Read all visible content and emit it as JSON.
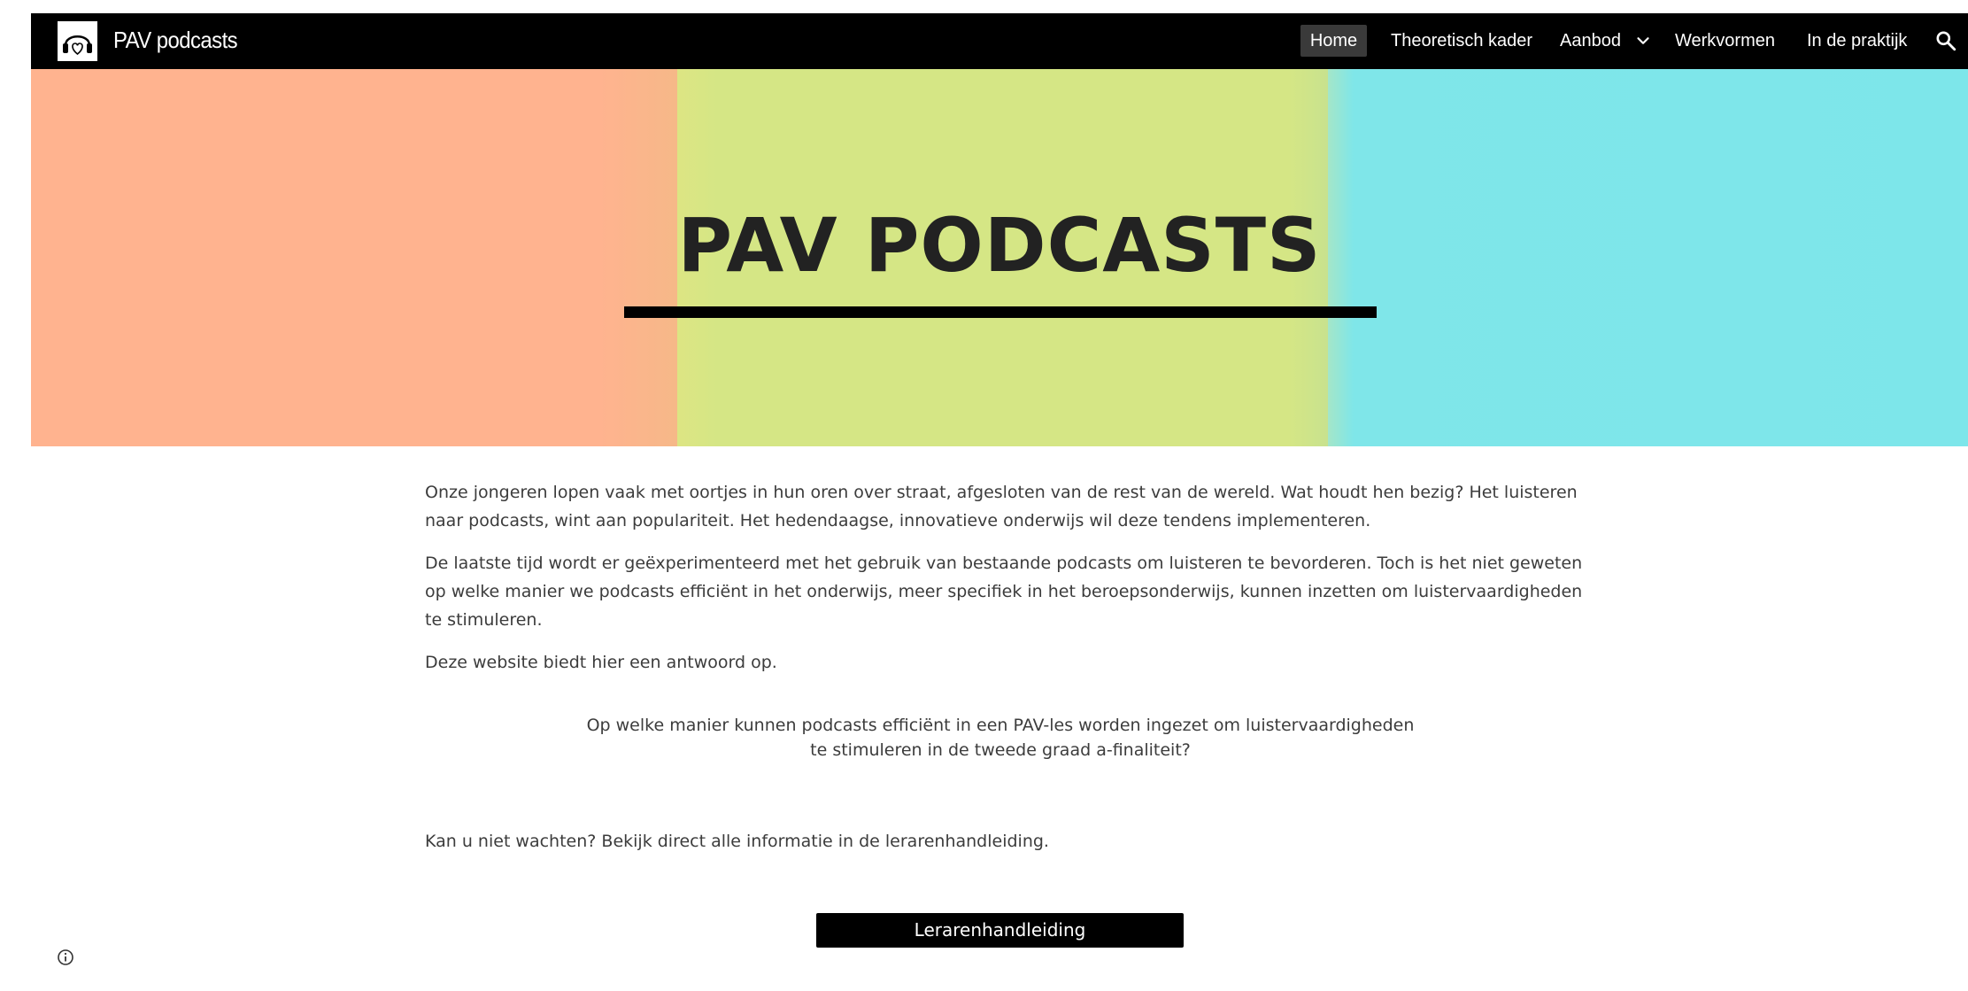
{
  "header": {
    "site_title": "PAV podcasts",
    "logo_icon": "headphones-heart-icon",
    "nav": [
      {
        "label": "Home",
        "active": true
      },
      {
        "label": "Theoretisch kader"
      },
      {
        "label": "Aanbod",
        "has_dropdown": true
      },
      {
        "label": "Werkvormen"
      },
      {
        "label": "In de praktijk"
      }
    ],
    "search_icon": "search-icon"
  },
  "banner": {
    "title": "PAV PODCASTS",
    "colors": {
      "orange": "#ffb38f",
      "green": "#d5e685",
      "cyan": "#7de6ea",
      "underline": "#000000"
    }
  },
  "main": {
    "paragraphs": [
      "Onze jongeren lopen vaak met oortjes in hun oren over straat, afgesloten van de rest van de wereld. Wat houdt hen bezig? Het luisteren naar podcasts, wint aan populariteit. Het hedendaagse, innovatieve onderwijs wil deze tendens implementeren.",
      "De laatste tijd wordt er geëxperimenteerd met het gebruik van bestaande podcasts om luisteren te bevorderen. Toch is het niet geweten op welke manier we podcasts efficiënt in het onderwijs, meer specifiek in het beroepsonderwijs, kunnen inzetten om luistervaardigheden te stimuleren.",
      "Deze website biedt hier een antwoord op."
    ],
    "question_line1": "Op welke manier kunnen podcasts efficiënt in een PAV-les worden ingezet om luistervaardigheden",
    "question_line2": "te stimuleren in de tweede graad a-finaliteit?",
    "cta_text": "Kan u niet wachten? Bekijk direct alle informatie in de lerarenhandleiding.",
    "cta_button": "Lerarenhandleiding"
  },
  "footer": {
    "info_icon": "info-icon"
  }
}
